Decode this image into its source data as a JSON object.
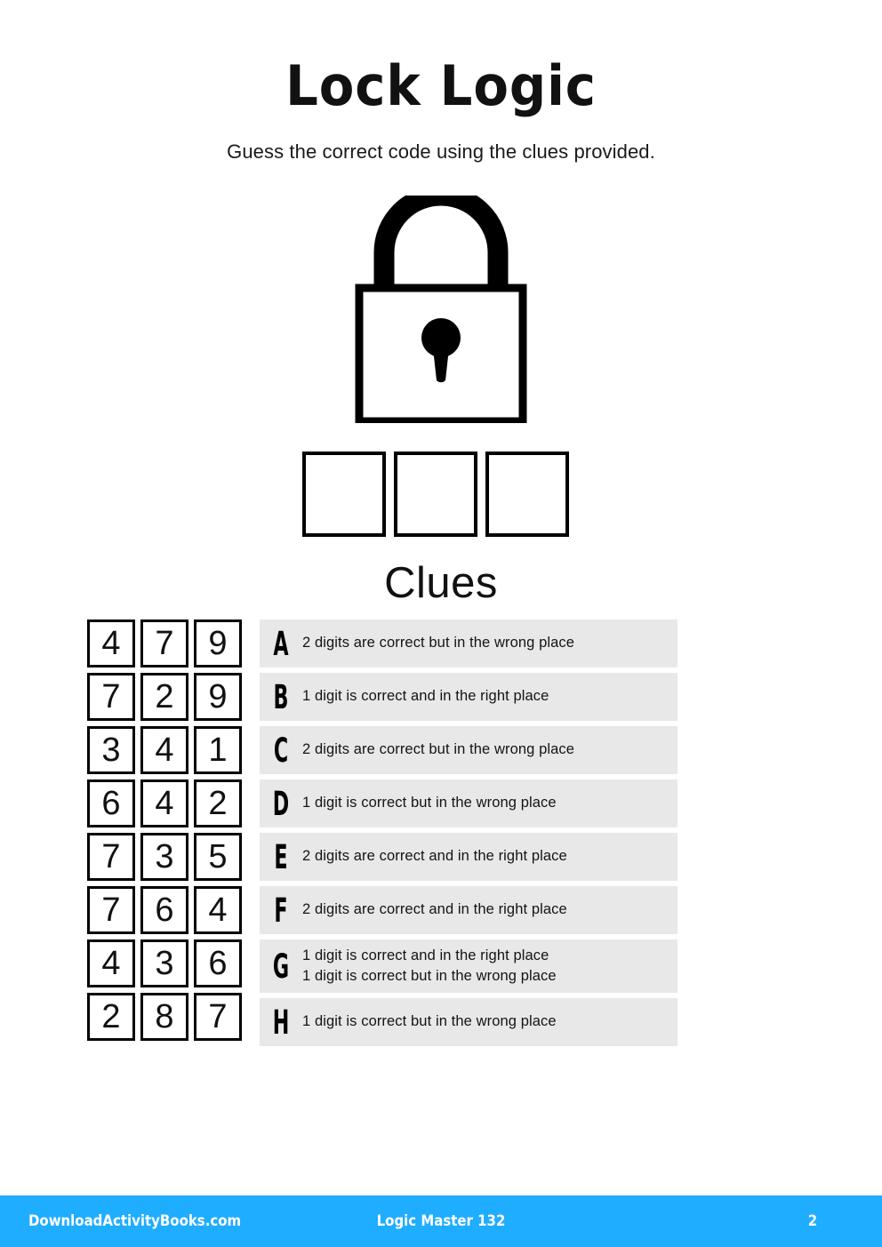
{
  "header": {
    "title": "Lock Logic",
    "subtitle": "Guess the correct code using the clues provided."
  },
  "lock": {
    "icon": "padlock-icon",
    "answer_boxes": [
      "",
      "",
      ""
    ],
    "answer_box_count": 3
  },
  "clues_section": {
    "heading": "Clues"
  },
  "guesses": [
    {
      "letter": "A",
      "digits": [
        "4",
        "7",
        "9"
      ]
    },
    {
      "letter": "B",
      "digits": [
        "7",
        "2",
        "9"
      ]
    },
    {
      "letter": "C",
      "digits": [
        "3",
        "4",
        "1"
      ]
    },
    {
      "letter": "D",
      "digits": [
        "6",
        "4",
        "2"
      ]
    },
    {
      "letter": "E",
      "digits": [
        "7",
        "3",
        "5"
      ]
    },
    {
      "letter": "F",
      "digits": [
        "7",
        "6",
        "4"
      ]
    },
    {
      "letter": "G",
      "digits": [
        "4",
        "3",
        "6"
      ]
    },
    {
      "letter": "H",
      "digits": [
        "2",
        "8",
        "7"
      ]
    }
  ],
  "clues": [
    {
      "letter": "A",
      "lines": [
        "2 digits are correct but in the wrong place"
      ]
    },
    {
      "letter": "B",
      "lines": [
        "1 digit is correct and in the right place"
      ]
    },
    {
      "letter": "C",
      "lines": [
        "2 digits are correct but in the wrong place"
      ]
    },
    {
      "letter": "D",
      "lines": [
        "1 digit is correct but in the wrong place"
      ]
    },
    {
      "letter": "E",
      "lines": [
        "2 digits are correct and in the right place"
      ]
    },
    {
      "letter": "F",
      "lines": [
        "2 digits are correct and in the right place"
      ]
    },
    {
      "letter": "G",
      "lines": [
        "1 digit is correct and in the right place",
        "1 digit is correct but in the wrong place"
      ]
    },
    {
      "letter": "H",
      "lines": [
        "1 digit is correct but in the wrong place"
      ]
    }
  ],
  "footer": {
    "site": "DownloadActivityBooks.com",
    "book": "Logic Master 132",
    "page": "2",
    "background_color": "#1fadff",
    "text_color": "#ffffff"
  },
  "colors": {
    "clue_row_background": "#e8e8e8",
    "ink": "#111111",
    "accent": "#1fadff"
  }
}
